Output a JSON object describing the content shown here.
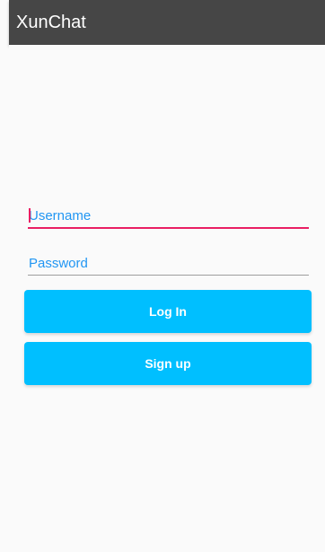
{
  "app_bar": {
    "title": "XunChat",
    "background_color": "#464646"
  },
  "login_form": {
    "username": {
      "placeholder": "Username",
      "value": ""
    },
    "password": {
      "placeholder": "Password",
      "value": ""
    },
    "login_label": "Log In",
    "signup_label": "Sign up"
  },
  "colors": {
    "accent": "#e91e63",
    "hint": "#2196f3",
    "button": "#00bfff"
  }
}
